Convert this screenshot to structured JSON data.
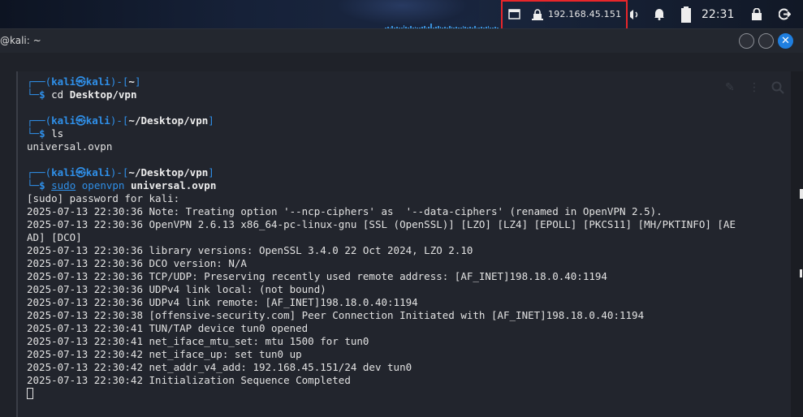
{
  "panel": {
    "ip_address": "192.168.45.151",
    "clock": "22:31",
    "icons": [
      "workspace-icon",
      "network-lock-icon",
      "volume-icon",
      "notification-bell-icon",
      "battery-icon",
      "lock-screen-icon",
      "logout-icon"
    ]
  },
  "window": {
    "title": "@kali: ~"
  },
  "prompt": {
    "top_left": "┌──(",
    "user": "kali",
    "at": "㉿",
    "host": "kali",
    "mid": ")-[",
    "close": "]",
    "bottom_left": "└─",
    "dollar": "$ "
  },
  "terminal": {
    "blocks": [
      {
        "path": "~",
        "command_parts": [
          {
            "t": "cd ",
            "s": "cmd"
          },
          {
            "t": "Desktop/vpn",
            "s": "cmd-bold"
          }
        ],
        "output": []
      },
      {
        "path": "~/Desktop/vpn",
        "command_parts": [
          {
            "t": "ls",
            "s": "cmd"
          }
        ],
        "output": [
          "universal.ovpn"
        ]
      },
      {
        "path": "~/Desktop/vpn",
        "command_parts": [
          {
            "t": "sudo",
            "s": "cmd-sudo"
          },
          {
            "t": " ",
            "s": "cmd"
          },
          {
            "t": "openvpn",
            "s": "cmd-blue"
          },
          {
            "t": " ",
            "s": "cmd"
          },
          {
            "t": "universal.ovpn",
            "s": "cmd-bold"
          }
        ],
        "output": [
          "[sudo] password for kali:",
          "2025-07-13 22:30:36 Note: Treating option '--ncp-ciphers' as  '--data-ciphers' (renamed in OpenVPN 2.5).",
          "2025-07-13 22:30:36 OpenVPN 2.6.13 x86_64-pc-linux-gnu [SSL (OpenSSL)] [LZO] [LZ4] [EPOLL] [PKCS11] [MH/PKTINFO] [AE",
          "AD] [DCO]",
          "2025-07-13 22:30:36 library versions: OpenSSL 3.4.0 22 Oct 2024, LZO 2.10",
          "2025-07-13 22:30:36 DCO version: N/A",
          "2025-07-13 22:30:36 TCP/UDP: Preserving recently used remote address: [AF_INET]198.18.0.40:1194",
          "2025-07-13 22:30:36 UDPv4 link local: (not bound)",
          "2025-07-13 22:30:36 UDPv4 link remote: [AF_INET]198.18.0.40:1194",
          "2025-07-13 22:30:38 [offensive-security.com] Peer Connection Initiated with [AF_INET]198.18.0.40:1194",
          "2025-07-13 22:30:41 TUN/TAP device tun0 opened",
          "2025-07-13 22:30:41 net_iface_mtu_set: mtu 1500 for tun0",
          "2025-07-13 22:30:42 net_iface_up: set tun0 up",
          "2025-07-13 22:30:42 net_addr_v4_add: 192.168.45.151/24 dev tun0",
          "2025-07-13 22:30:42 Initialization Sequence Completed"
        ]
      }
    ]
  }
}
